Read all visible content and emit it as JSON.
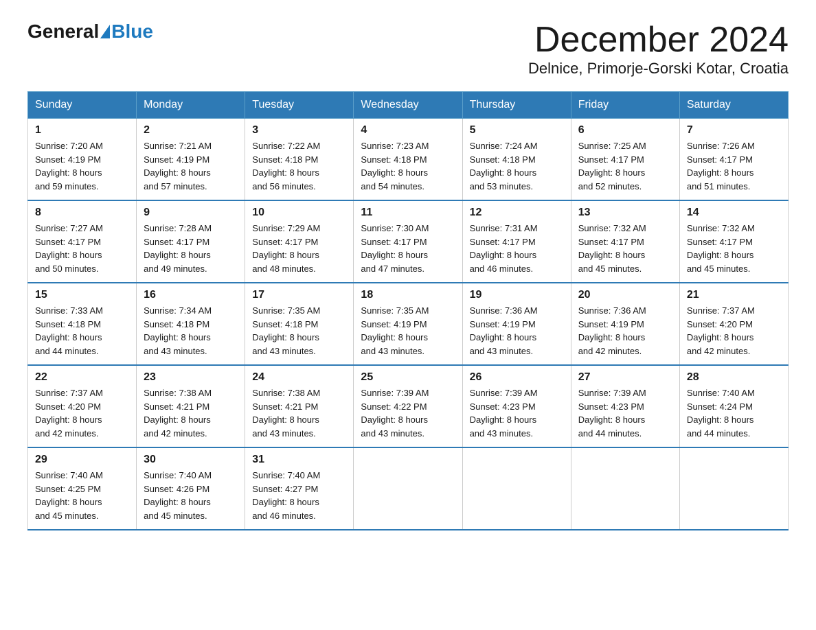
{
  "header": {
    "logo_general": "General",
    "logo_blue": "Blue",
    "month_title": "December 2024",
    "location": "Delnice, Primorje-Gorski Kotar, Croatia"
  },
  "weekdays": [
    "Sunday",
    "Monday",
    "Tuesday",
    "Wednesday",
    "Thursday",
    "Friday",
    "Saturday"
  ],
  "weeks": [
    [
      {
        "day": "1",
        "sunrise": "7:20 AM",
        "sunset": "4:19 PM",
        "daylight": "8 hours and 59 minutes."
      },
      {
        "day": "2",
        "sunrise": "7:21 AM",
        "sunset": "4:19 PM",
        "daylight": "8 hours and 57 minutes."
      },
      {
        "day": "3",
        "sunrise": "7:22 AM",
        "sunset": "4:18 PM",
        "daylight": "8 hours and 56 minutes."
      },
      {
        "day": "4",
        "sunrise": "7:23 AM",
        "sunset": "4:18 PM",
        "daylight": "8 hours and 54 minutes."
      },
      {
        "day": "5",
        "sunrise": "7:24 AM",
        "sunset": "4:18 PM",
        "daylight": "8 hours and 53 minutes."
      },
      {
        "day": "6",
        "sunrise": "7:25 AM",
        "sunset": "4:17 PM",
        "daylight": "8 hours and 52 minutes."
      },
      {
        "day": "7",
        "sunrise": "7:26 AM",
        "sunset": "4:17 PM",
        "daylight": "8 hours and 51 minutes."
      }
    ],
    [
      {
        "day": "8",
        "sunrise": "7:27 AM",
        "sunset": "4:17 PM",
        "daylight": "8 hours and 50 minutes."
      },
      {
        "day": "9",
        "sunrise": "7:28 AM",
        "sunset": "4:17 PM",
        "daylight": "8 hours and 49 minutes."
      },
      {
        "day": "10",
        "sunrise": "7:29 AM",
        "sunset": "4:17 PM",
        "daylight": "8 hours and 48 minutes."
      },
      {
        "day": "11",
        "sunrise": "7:30 AM",
        "sunset": "4:17 PM",
        "daylight": "8 hours and 47 minutes."
      },
      {
        "day": "12",
        "sunrise": "7:31 AM",
        "sunset": "4:17 PM",
        "daylight": "8 hours and 46 minutes."
      },
      {
        "day": "13",
        "sunrise": "7:32 AM",
        "sunset": "4:17 PM",
        "daylight": "8 hours and 45 minutes."
      },
      {
        "day": "14",
        "sunrise": "7:32 AM",
        "sunset": "4:17 PM",
        "daylight": "8 hours and 45 minutes."
      }
    ],
    [
      {
        "day": "15",
        "sunrise": "7:33 AM",
        "sunset": "4:18 PM",
        "daylight": "8 hours and 44 minutes."
      },
      {
        "day": "16",
        "sunrise": "7:34 AM",
        "sunset": "4:18 PM",
        "daylight": "8 hours and 43 minutes."
      },
      {
        "day": "17",
        "sunrise": "7:35 AM",
        "sunset": "4:18 PM",
        "daylight": "8 hours and 43 minutes."
      },
      {
        "day": "18",
        "sunrise": "7:35 AM",
        "sunset": "4:19 PM",
        "daylight": "8 hours and 43 minutes."
      },
      {
        "day": "19",
        "sunrise": "7:36 AM",
        "sunset": "4:19 PM",
        "daylight": "8 hours and 43 minutes."
      },
      {
        "day": "20",
        "sunrise": "7:36 AM",
        "sunset": "4:19 PM",
        "daylight": "8 hours and 42 minutes."
      },
      {
        "day": "21",
        "sunrise": "7:37 AM",
        "sunset": "4:20 PM",
        "daylight": "8 hours and 42 minutes."
      }
    ],
    [
      {
        "day": "22",
        "sunrise": "7:37 AM",
        "sunset": "4:20 PM",
        "daylight": "8 hours and 42 minutes."
      },
      {
        "day": "23",
        "sunrise": "7:38 AM",
        "sunset": "4:21 PM",
        "daylight": "8 hours and 42 minutes."
      },
      {
        "day": "24",
        "sunrise": "7:38 AM",
        "sunset": "4:21 PM",
        "daylight": "8 hours and 43 minutes."
      },
      {
        "day": "25",
        "sunrise": "7:39 AM",
        "sunset": "4:22 PM",
        "daylight": "8 hours and 43 minutes."
      },
      {
        "day": "26",
        "sunrise": "7:39 AM",
        "sunset": "4:23 PM",
        "daylight": "8 hours and 43 minutes."
      },
      {
        "day": "27",
        "sunrise": "7:39 AM",
        "sunset": "4:23 PM",
        "daylight": "8 hours and 44 minutes."
      },
      {
        "day": "28",
        "sunrise": "7:40 AM",
        "sunset": "4:24 PM",
        "daylight": "8 hours and 44 minutes."
      }
    ],
    [
      {
        "day": "29",
        "sunrise": "7:40 AM",
        "sunset": "4:25 PM",
        "daylight": "8 hours and 45 minutes."
      },
      {
        "day": "30",
        "sunrise": "7:40 AM",
        "sunset": "4:26 PM",
        "daylight": "8 hours and 45 minutes."
      },
      {
        "day": "31",
        "sunrise": "7:40 AM",
        "sunset": "4:27 PM",
        "daylight": "8 hours and 46 minutes."
      },
      null,
      null,
      null,
      null
    ]
  ],
  "labels": {
    "sunrise": "Sunrise:",
    "sunset": "Sunset:",
    "daylight": "Daylight:"
  }
}
